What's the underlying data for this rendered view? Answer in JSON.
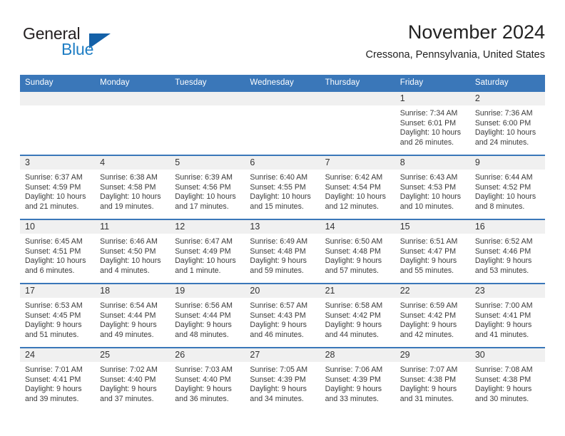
{
  "brand": {
    "line1": "General",
    "line2": "Blue",
    "triangle_icon": "brand-triangle-icon",
    "colors": {
      "text": "#231f20",
      "blue": "#1f7ec4",
      "triangle": "#1461a8"
    }
  },
  "header": {
    "title": "November 2024",
    "subtitle": "Cressona, Pennsylvania, United States"
  },
  "theme": {
    "header_blue": "#3a77b9",
    "daynum_band": "#f0f0f0",
    "text": "#3a3a3a"
  },
  "calendar": {
    "weekdays": [
      "Sunday",
      "Monday",
      "Tuesday",
      "Wednesday",
      "Thursday",
      "Friday",
      "Saturday"
    ],
    "weeks": [
      [
        {
          "day": "",
          "sunrise": "",
          "sunset": "",
          "daylight_line1": "",
          "daylight_line2": ""
        },
        {
          "day": "",
          "sunrise": "",
          "sunset": "",
          "daylight_line1": "",
          "daylight_line2": ""
        },
        {
          "day": "",
          "sunrise": "",
          "sunset": "",
          "daylight_line1": "",
          "daylight_line2": ""
        },
        {
          "day": "",
          "sunrise": "",
          "sunset": "",
          "daylight_line1": "",
          "daylight_line2": ""
        },
        {
          "day": "",
          "sunrise": "",
          "sunset": "",
          "daylight_line1": "",
          "daylight_line2": ""
        },
        {
          "day": "1",
          "sunrise": "Sunrise: 7:34 AM",
          "sunset": "Sunset: 6:01 PM",
          "daylight_line1": "Daylight: 10 hours",
          "daylight_line2": "and 26 minutes."
        },
        {
          "day": "2",
          "sunrise": "Sunrise: 7:36 AM",
          "sunset": "Sunset: 6:00 PM",
          "daylight_line1": "Daylight: 10 hours",
          "daylight_line2": "and 24 minutes."
        }
      ],
      [
        {
          "day": "3",
          "sunrise": "Sunrise: 6:37 AM",
          "sunset": "Sunset: 4:59 PM",
          "daylight_line1": "Daylight: 10 hours",
          "daylight_line2": "and 21 minutes."
        },
        {
          "day": "4",
          "sunrise": "Sunrise: 6:38 AM",
          "sunset": "Sunset: 4:58 PM",
          "daylight_line1": "Daylight: 10 hours",
          "daylight_line2": "and 19 minutes."
        },
        {
          "day": "5",
          "sunrise": "Sunrise: 6:39 AM",
          "sunset": "Sunset: 4:56 PM",
          "daylight_line1": "Daylight: 10 hours",
          "daylight_line2": "and 17 minutes."
        },
        {
          "day": "6",
          "sunrise": "Sunrise: 6:40 AM",
          "sunset": "Sunset: 4:55 PM",
          "daylight_line1": "Daylight: 10 hours",
          "daylight_line2": "and 15 minutes."
        },
        {
          "day": "7",
          "sunrise": "Sunrise: 6:42 AM",
          "sunset": "Sunset: 4:54 PM",
          "daylight_line1": "Daylight: 10 hours",
          "daylight_line2": "and 12 minutes."
        },
        {
          "day": "8",
          "sunrise": "Sunrise: 6:43 AM",
          "sunset": "Sunset: 4:53 PM",
          "daylight_line1": "Daylight: 10 hours",
          "daylight_line2": "and 10 minutes."
        },
        {
          "day": "9",
          "sunrise": "Sunrise: 6:44 AM",
          "sunset": "Sunset: 4:52 PM",
          "daylight_line1": "Daylight: 10 hours",
          "daylight_line2": "and 8 minutes."
        }
      ],
      [
        {
          "day": "10",
          "sunrise": "Sunrise: 6:45 AM",
          "sunset": "Sunset: 4:51 PM",
          "daylight_line1": "Daylight: 10 hours",
          "daylight_line2": "and 6 minutes."
        },
        {
          "day": "11",
          "sunrise": "Sunrise: 6:46 AM",
          "sunset": "Sunset: 4:50 PM",
          "daylight_line1": "Daylight: 10 hours",
          "daylight_line2": "and 4 minutes."
        },
        {
          "day": "12",
          "sunrise": "Sunrise: 6:47 AM",
          "sunset": "Sunset: 4:49 PM",
          "daylight_line1": "Daylight: 10 hours",
          "daylight_line2": "and 1 minute."
        },
        {
          "day": "13",
          "sunrise": "Sunrise: 6:49 AM",
          "sunset": "Sunset: 4:48 PM",
          "daylight_line1": "Daylight: 9 hours",
          "daylight_line2": "and 59 minutes."
        },
        {
          "day": "14",
          "sunrise": "Sunrise: 6:50 AM",
          "sunset": "Sunset: 4:48 PM",
          "daylight_line1": "Daylight: 9 hours",
          "daylight_line2": "and 57 minutes."
        },
        {
          "day": "15",
          "sunrise": "Sunrise: 6:51 AM",
          "sunset": "Sunset: 4:47 PM",
          "daylight_line1": "Daylight: 9 hours",
          "daylight_line2": "and 55 minutes."
        },
        {
          "day": "16",
          "sunrise": "Sunrise: 6:52 AM",
          "sunset": "Sunset: 4:46 PM",
          "daylight_line1": "Daylight: 9 hours",
          "daylight_line2": "and 53 minutes."
        }
      ],
      [
        {
          "day": "17",
          "sunrise": "Sunrise: 6:53 AM",
          "sunset": "Sunset: 4:45 PM",
          "daylight_line1": "Daylight: 9 hours",
          "daylight_line2": "and 51 minutes."
        },
        {
          "day": "18",
          "sunrise": "Sunrise: 6:54 AM",
          "sunset": "Sunset: 4:44 PM",
          "daylight_line1": "Daylight: 9 hours",
          "daylight_line2": "and 49 minutes."
        },
        {
          "day": "19",
          "sunrise": "Sunrise: 6:56 AM",
          "sunset": "Sunset: 4:44 PM",
          "daylight_line1": "Daylight: 9 hours",
          "daylight_line2": "and 48 minutes."
        },
        {
          "day": "20",
          "sunrise": "Sunrise: 6:57 AM",
          "sunset": "Sunset: 4:43 PM",
          "daylight_line1": "Daylight: 9 hours",
          "daylight_line2": "and 46 minutes."
        },
        {
          "day": "21",
          "sunrise": "Sunrise: 6:58 AM",
          "sunset": "Sunset: 4:42 PM",
          "daylight_line1": "Daylight: 9 hours",
          "daylight_line2": "and 44 minutes."
        },
        {
          "day": "22",
          "sunrise": "Sunrise: 6:59 AM",
          "sunset": "Sunset: 4:42 PM",
          "daylight_line1": "Daylight: 9 hours",
          "daylight_line2": "and 42 minutes."
        },
        {
          "day": "23",
          "sunrise": "Sunrise: 7:00 AM",
          "sunset": "Sunset: 4:41 PM",
          "daylight_line1": "Daylight: 9 hours",
          "daylight_line2": "and 41 minutes."
        }
      ],
      [
        {
          "day": "24",
          "sunrise": "Sunrise: 7:01 AM",
          "sunset": "Sunset: 4:41 PM",
          "daylight_line1": "Daylight: 9 hours",
          "daylight_line2": "and 39 minutes."
        },
        {
          "day": "25",
          "sunrise": "Sunrise: 7:02 AM",
          "sunset": "Sunset: 4:40 PM",
          "daylight_line1": "Daylight: 9 hours",
          "daylight_line2": "and 37 minutes."
        },
        {
          "day": "26",
          "sunrise": "Sunrise: 7:03 AM",
          "sunset": "Sunset: 4:40 PM",
          "daylight_line1": "Daylight: 9 hours",
          "daylight_line2": "and 36 minutes."
        },
        {
          "day": "27",
          "sunrise": "Sunrise: 7:05 AM",
          "sunset": "Sunset: 4:39 PM",
          "daylight_line1": "Daylight: 9 hours",
          "daylight_line2": "and 34 minutes."
        },
        {
          "day": "28",
          "sunrise": "Sunrise: 7:06 AM",
          "sunset": "Sunset: 4:39 PM",
          "daylight_line1": "Daylight: 9 hours",
          "daylight_line2": "and 33 minutes."
        },
        {
          "day": "29",
          "sunrise": "Sunrise: 7:07 AM",
          "sunset": "Sunset: 4:38 PM",
          "daylight_line1": "Daylight: 9 hours",
          "daylight_line2": "and 31 minutes."
        },
        {
          "day": "30",
          "sunrise": "Sunrise: 7:08 AM",
          "sunset": "Sunset: 4:38 PM",
          "daylight_line1": "Daylight: 9 hours",
          "daylight_line2": "and 30 minutes."
        }
      ]
    ]
  }
}
